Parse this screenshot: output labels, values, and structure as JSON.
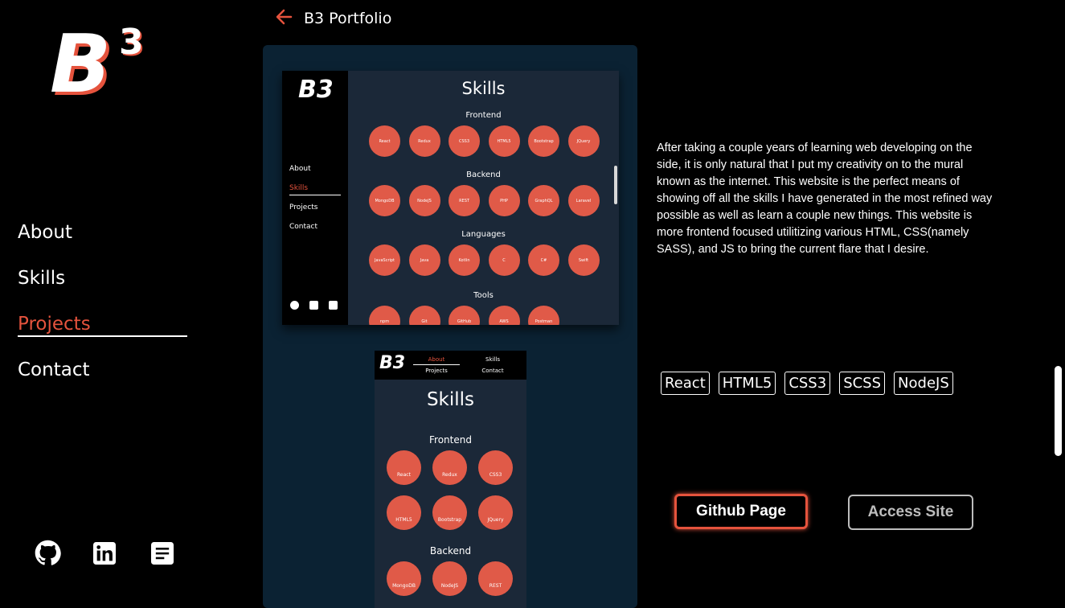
{
  "logo": {
    "text": "B",
    "sup": "3"
  },
  "nav": [
    {
      "label": "About"
    },
    {
      "label": "Skills"
    },
    {
      "label": "Projects"
    },
    {
      "label": "Contact"
    }
  ],
  "social": [
    "github-icon",
    "linkedin-icon",
    "resume-icon"
  ],
  "header": {
    "title": "B3 Portfolio"
  },
  "preview_desktop": {
    "logo": "B3",
    "nav": [
      "About",
      "Skills",
      "Projects",
      "Contact"
    ],
    "title": "Skills",
    "sections": [
      {
        "title": "Frontend",
        "items": [
          "React",
          "Redux",
          "CSS3",
          "HTML5",
          "Bootstrap",
          "JQuery"
        ]
      },
      {
        "title": "Backend",
        "items": [
          "MongoDB",
          "NodeJS",
          "REST",
          "PHP",
          "GraphQL",
          "Laravel"
        ]
      },
      {
        "title": "Languages",
        "items": [
          "JavaScript",
          "Java",
          "Kotlin",
          "C",
          "C#",
          "Swift"
        ]
      },
      {
        "title": "Tools",
        "items": [
          "npm",
          "Git",
          "GitHub",
          "AWS",
          "Postman"
        ]
      }
    ]
  },
  "preview_mobile": {
    "logo": "B3",
    "nav": [
      "About",
      "Skills",
      "Projects",
      "Contact"
    ],
    "title": "Skills",
    "sections": [
      {
        "title": "Frontend",
        "items": [
          "React",
          "Redux",
          "CSS3",
          "HTML5",
          "Bootstrap",
          "JQuery"
        ]
      },
      {
        "title": "Backend",
        "items": [
          "MongoDB",
          "NodeJS",
          "REST"
        ]
      }
    ]
  },
  "description": "After taking a couple years of learning web developing on the side, it is only natural that I put my creativity on to the mural known as the internet. This website is the perfect means of showing off all the skills I have generated in the most refined way possible as well as learn a couple new things. This website is more frontend focused utilitizing various HTML, CSS(namely SASS), and JS to bring the current flare that I desire.",
  "tags": [
    "React",
    "HTML5",
    "CSS3",
    "SCSS",
    "NodeJS"
  ],
  "buttons": {
    "github": "Github Page",
    "access": "Access Site"
  },
  "colors": {
    "accent": "#e5533d",
    "panel": "#0b2233",
    "circle": "#e05a48"
  }
}
